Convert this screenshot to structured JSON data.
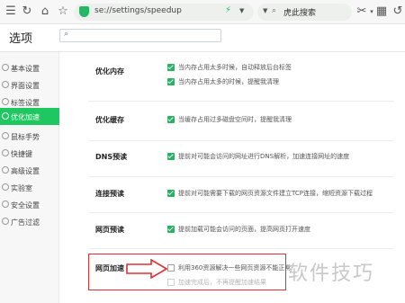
{
  "toolbar": {
    "url": "se://settings/speedup",
    "search_text": "虎此搜索"
  },
  "header": {
    "title": "选项",
    "find_placeholder": ""
  },
  "sidebar": {
    "items": [
      {
        "label": "基本设置",
        "active": false
      },
      {
        "label": "界面设置",
        "active": false
      },
      {
        "label": "标签设置",
        "active": false
      },
      {
        "label": "优化加速",
        "active": true
      },
      {
        "label": "鼠标手势",
        "active": false
      },
      {
        "label": "快捷键",
        "active": false
      },
      {
        "label": "高级设置",
        "active": false
      },
      {
        "label": "实验室",
        "active": false
      },
      {
        "label": "安全设置",
        "active": false
      },
      {
        "label": "广告过滤",
        "active": false
      }
    ]
  },
  "sections": [
    {
      "title": "优化内存",
      "options": [
        {
          "text": "当内存占用太多时候，自动释放后台标签",
          "checked": true
        },
        {
          "text": "当内存占用太多的时候，提醒我清理",
          "checked": true
        }
      ]
    },
    {
      "title": "优化缓存",
      "options": [
        {
          "text": "当缓存占用过多磁盘空间时，提醒我清理",
          "checked": true
        }
      ]
    },
    {
      "title": "DNS预读",
      "options": [
        {
          "text": "提前对可能会访问的网址进行DNS解析，加速连接网址的速度",
          "checked": true
        }
      ]
    },
    {
      "title": "连接预读",
      "options": [
        {
          "text": "提前对可能需要下载的网页资源文件建立TCP连接，缩短资源下载过程",
          "checked": true
        }
      ]
    },
    {
      "title": "网页预读",
      "options": [
        {
          "text": "提前加载可能会访问的页面，提高网页打开速度",
          "checked": true
        }
      ]
    },
    {
      "title": "网页加速",
      "options": [
        {
          "text": "利用360资源解决一些网页资源不能正常",
          "checked": false
        },
        {
          "text": "加速完成后，不再提醒加速结果",
          "checked": false,
          "disabled": true
        }
      ]
    }
  ],
  "watermark": "软件技巧",
  "colors": {
    "accent": "#1ec75f",
    "annotation": "#e03030"
  }
}
